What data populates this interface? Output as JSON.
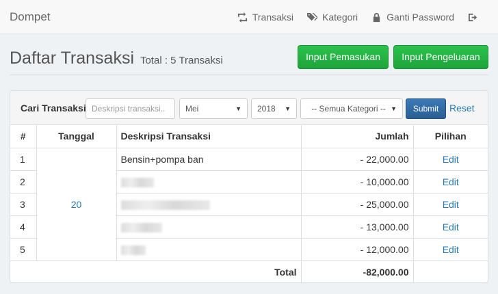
{
  "navbar": {
    "brand": "Dompet",
    "links": [
      {
        "label": "Transaksi",
        "icon": "retweet-icon"
      },
      {
        "label": "Kategori",
        "icon": "tags-icon"
      },
      {
        "label": "Ganti Password",
        "icon": "lock-icon"
      },
      {
        "label": "",
        "icon": "logout-icon"
      }
    ]
  },
  "header": {
    "title": "Daftar Transaksi",
    "subtitle": "Total : 5 Transaksi",
    "btn_income": "Input Pemasukan",
    "btn_expense": "Input Pengeluaran"
  },
  "search": {
    "label": "Cari Transaksi",
    "placeholder": "Deskripsi transaksi..",
    "month": "Mei",
    "year": "2018",
    "category": "-- Semua Kategori --",
    "submit": "Submit",
    "reset": "Reset"
  },
  "table": {
    "headers": [
      "#",
      "Tanggal",
      "Deskripsi Transaksi",
      "Jumlah",
      "Pilihan"
    ],
    "date": "20",
    "rows": [
      {
        "num": "1",
        "desc": "Bensin+pompa ban",
        "amount": "- 22,000.00",
        "action": "Edit"
      },
      {
        "num": "2",
        "desc": "",
        "amount": "- 10,000.00",
        "action": "Edit"
      },
      {
        "num": "3",
        "desc": "",
        "amount": "- 25,000.00",
        "action": "Edit"
      },
      {
        "num": "4",
        "desc": "",
        "amount": "- 13,000.00",
        "action": "Edit"
      },
      {
        "num": "5",
        "desc": "",
        "amount": "- 12,000.00",
        "action": "Edit"
      }
    ],
    "total_label": "Total",
    "total_value": "-82,000.00"
  },
  "colors": {
    "primary_green": "#1ea43c",
    "link_blue": "#2a7ab5",
    "submit_blue": "#2a5f94"
  }
}
